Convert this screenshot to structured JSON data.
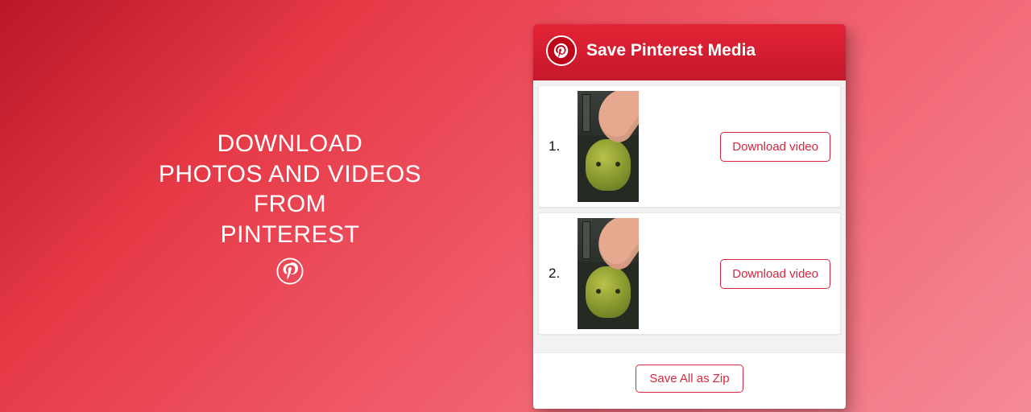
{
  "promo": {
    "line1": "DOWNLOAD",
    "line2": "PHOTOS AND VIDEOS",
    "line3": "FROM",
    "line4": "PINTEREST"
  },
  "panel": {
    "title": "Save Pinterest Media",
    "items": [
      {
        "num": "1.",
        "button": "Download video"
      },
      {
        "num": "2.",
        "button": "Download video"
      }
    ],
    "footer_button": "Save All as Zip"
  },
  "colors": {
    "accent": "#d7263d"
  }
}
